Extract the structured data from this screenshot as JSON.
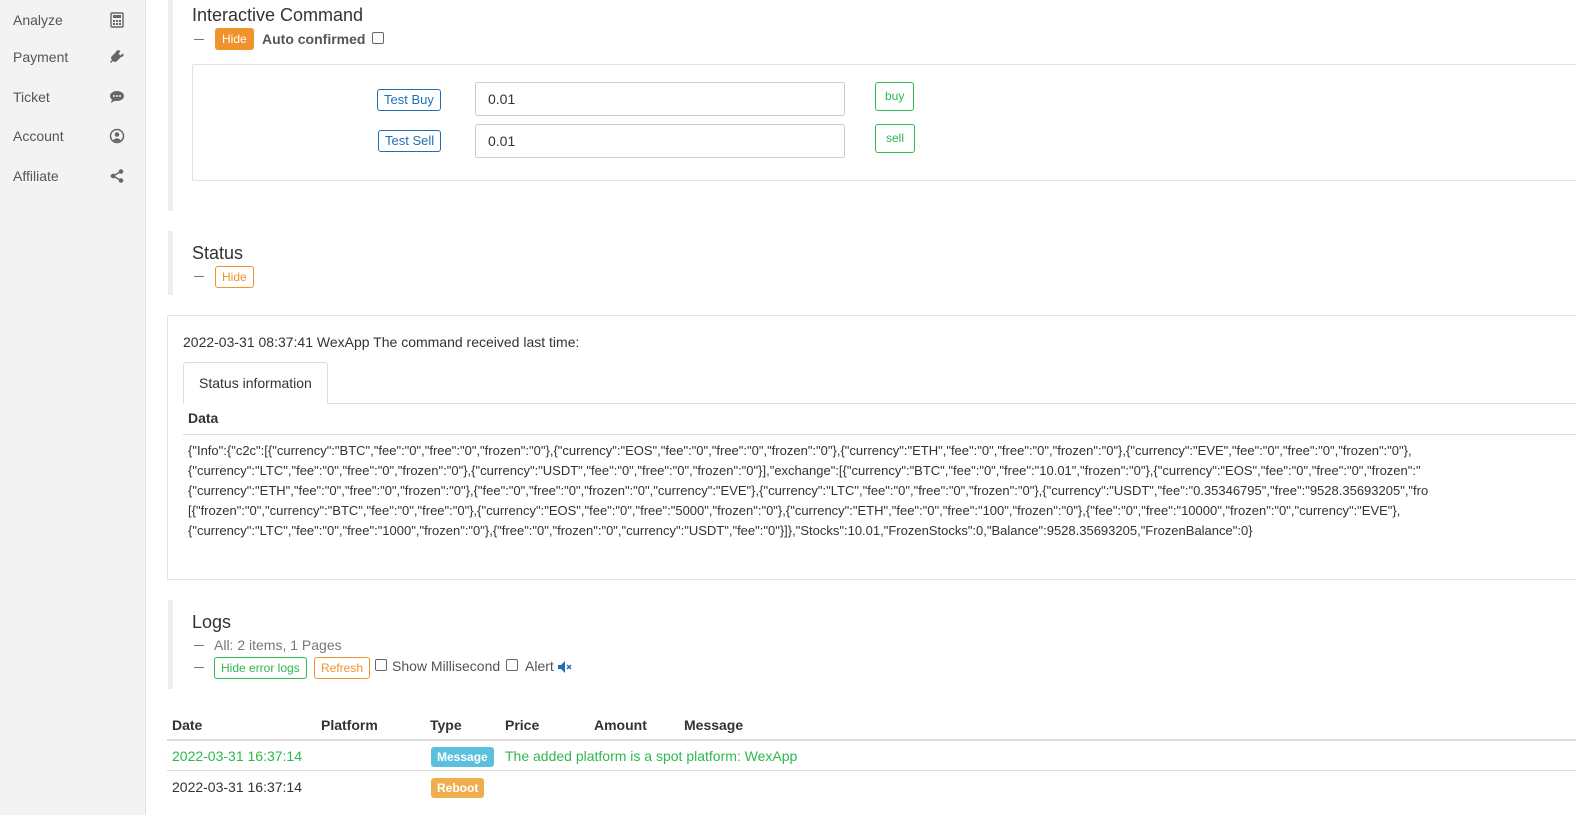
{
  "sidebar": {
    "items": [
      {
        "label": "Analyze",
        "icon": "calculator-icon"
      },
      {
        "label": "Payment",
        "icon": "plug-icon"
      },
      {
        "label": "Ticket",
        "icon": "comment-icon"
      },
      {
        "label": "Account",
        "icon": "user-circle-icon"
      },
      {
        "label": "Affiliate",
        "icon": "share-icon"
      }
    ]
  },
  "interactive": {
    "title": "Interactive Command",
    "hide_label": "Hide",
    "auto_confirmed_label": "Auto confirmed",
    "commands": [
      {
        "label": "Test Buy",
        "value": "0.01",
        "action": "buy"
      },
      {
        "label": "Test Sell",
        "value": "0.01",
        "action": "sell"
      }
    ]
  },
  "status": {
    "title": "Status",
    "hide_label": "Hide",
    "last_command": "2022-03-31 08:37:41 WexApp The command received last time:",
    "tab_label": "Status information",
    "data_header": "Data",
    "data_lines": [
      "{\"Info\":{\"c2c\":[{\"currency\":\"BTC\",\"fee\":\"0\",\"free\":\"0\",\"frozen\":\"0\"},{\"currency\":\"EOS\",\"fee\":\"0\",\"free\":\"0\",\"frozen\":\"0\"},{\"currency\":\"ETH\",\"fee\":\"0\",\"free\":\"0\",\"frozen\":\"0\"},{\"currency\":\"EVE\",\"fee\":\"0\",\"free\":\"0\",\"frozen\":\"0\"},",
      "{\"currency\":\"LTC\",\"fee\":\"0\",\"free\":\"0\",\"frozen\":\"0\"},{\"currency\":\"USDT\",\"fee\":\"0\",\"free\":\"0\",\"frozen\":\"0\"}],\"exchange\":[{\"currency\":\"BTC\",\"fee\":\"0\",\"free\":\"10.01\",\"frozen\":\"0\"},{\"currency\":\"EOS\",\"fee\":\"0\",\"free\":\"0\",\"frozen\":\"",
      "{\"currency\":\"ETH\",\"fee\":\"0\",\"free\":\"0\",\"frozen\":\"0\"},{\"fee\":\"0\",\"free\":\"0\",\"frozen\":\"0\",\"currency\":\"EVE\"},{\"currency\":\"LTC\",\"fee\":\"0\",\"free\":\"0\",\"frozen\":\"0\"},{\"currency\":\"USDT\",\"fee\":\"0.35346795\",\"free\":\"9528.35693205\",\"fro",
      "[{\"frozen\":\"0\",\"currency\":\"BTC\",\"fee\":\"0\",\"free\":\"0\"},{\"currency\":\"EOS\",\"fee\":\"0\",\"free\":\"5000\",\"frozen\":\"0\"},{\"currency\":\"ETH\",\"fee\":\"0\",\"free\":\"100\",\"frozen\":\"0\"},{\"fee\":\"0\",\"free\":\"10000\",\"frozen\":\"0\",\"currency\":\"EVE\"},",
      "{\"currency\":\"LTC\",\"fee\":\"0\",\"free\":\"1000\",\"frozen\":\"0\"},{\"free\":\"0\",\"frozen\":\"0\",\"currency\":\"USDT\",\"fee\":\"0\"}]},\"Stocks\":10.01,\"FrozenStocks\":0,\"Balance\":9528.35693205,\"FrozenBalance\":0}"
    ]
  },
  "logs": {
    "title": "Logs",
    "summary": "All: 2 items, 1 Pages",
    "hide_error_label": "Hide error logs",
    "refresh_label": "Refresh",
    "show_ms_label": "Show Millisecond",
    "alert_label": "Alert",
    "columns": [
      "Date",
      "Platform",
      "Type",
      "Price",
      "Amount",
      "Message"
    ],
    "rows": [
      {
        "date": "2022-03-31 16:37:14",
        "platform": "",
        "type": "Message",
        "price": "",
        "amount": "",
        "message": "The added platform is a spot platform: WexApp"
      },
      {
        "date": "2022-03-31 16:37:14",
        "platform": "",
        "type": "Reboot",
        "price": "",
        "amount": "",
        "message": ""
      }
    ]
  },
  "colors": {
    "accent_orange": "#f0932b",
    "green": "#2eb84e",
    "blue": "#1f6fb8",
    "message_badge": "#5bc0de",
    "reboot_badge": "#f0ad4e"
  }
}
